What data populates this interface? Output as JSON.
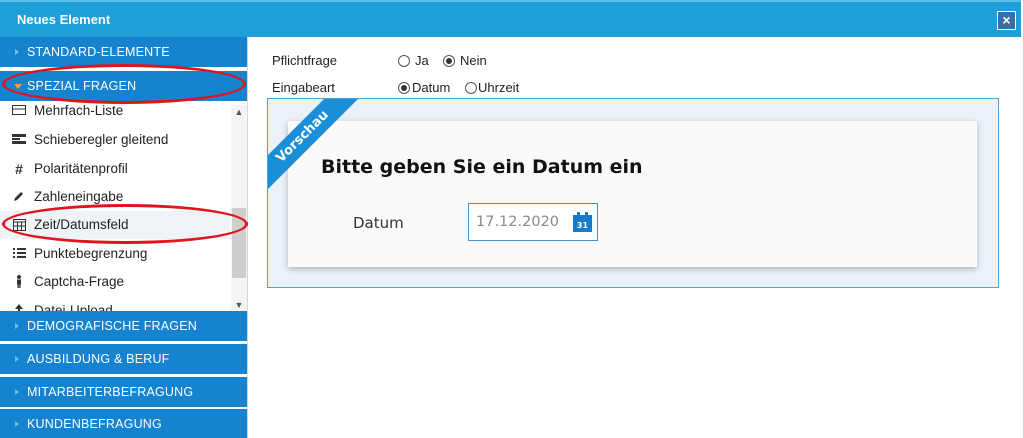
{
  "window": {
    "title": "Neues Element",
    "close_label": "×"
  },
  "sidebar": {
    "categories_top": [
      {
        "label": "STANDARD-ELEMENTE",
        "expanded": false
      },
      {
        "label": "SPEZIAL FRAGEN",
        "expanded": true
      }
    ],
    "items": [
      {
        "label": "Mehrfach-Liste",
        "icon": "list-box-icon"
      },
      {
        "label": "Schieberegler gleitend",
        "icon": "slider-icon"
      },
      {
        "label": "Polaritätenprofil",
        "icon": "hash-icon"
      },
      {
        "label": "Zahleneingabe",
        "icon": "pencil-icon"
      },
      {
        "label": "Zeit/Datumsfeld",
        "icon": "calendar-grid-icon"
      },
      {
        "label": "Punktebegrenzung",
        "icon": "bullet-list-icon"
      },
      {
        "label": "Captcha-Frage",
        "icon": "person-icon"
      },
      {
        "label": "Datei-Upload",
        "icon": "upload-icon"
      }
    ],
    "categories_bottom": [
      {
        "label": "DEMOGRAFISCHE FRAGEN"
      },
      {
        "label": "AUSBILDUNG & BERUF"
      },
      {
        "label": "MITARBEITERBEFRAGUNG"
      },
      {
        "label": "KUNDENBEFRAGUNG"
      }
    ]
  },
  "form": {
    "required": {
      "label": "Pflichtfrage",
      "options": [
        "Ja",
        "Nein"
      ],
      "selected": "Nein"
    },
    "input_type": {
      "label": "Eingabeart",
      "options": [
        "Datum",
        "Uhrzeit"
      ],
      "selected": "Datum"
    }
  },
  "preview": {
    "ribbon": "Vorschau",
    "question": "Bitte geben Sie ein Datum ein",
    "field_label": "Datum",
    "field_value": "17.12.2020",
    "calendar_day": "31"
  },
  "colors": {
    "titlebar": "#1e9fd8",
    "category": "#1583cf",
    "annotation": "#e0151b"
  }
}
